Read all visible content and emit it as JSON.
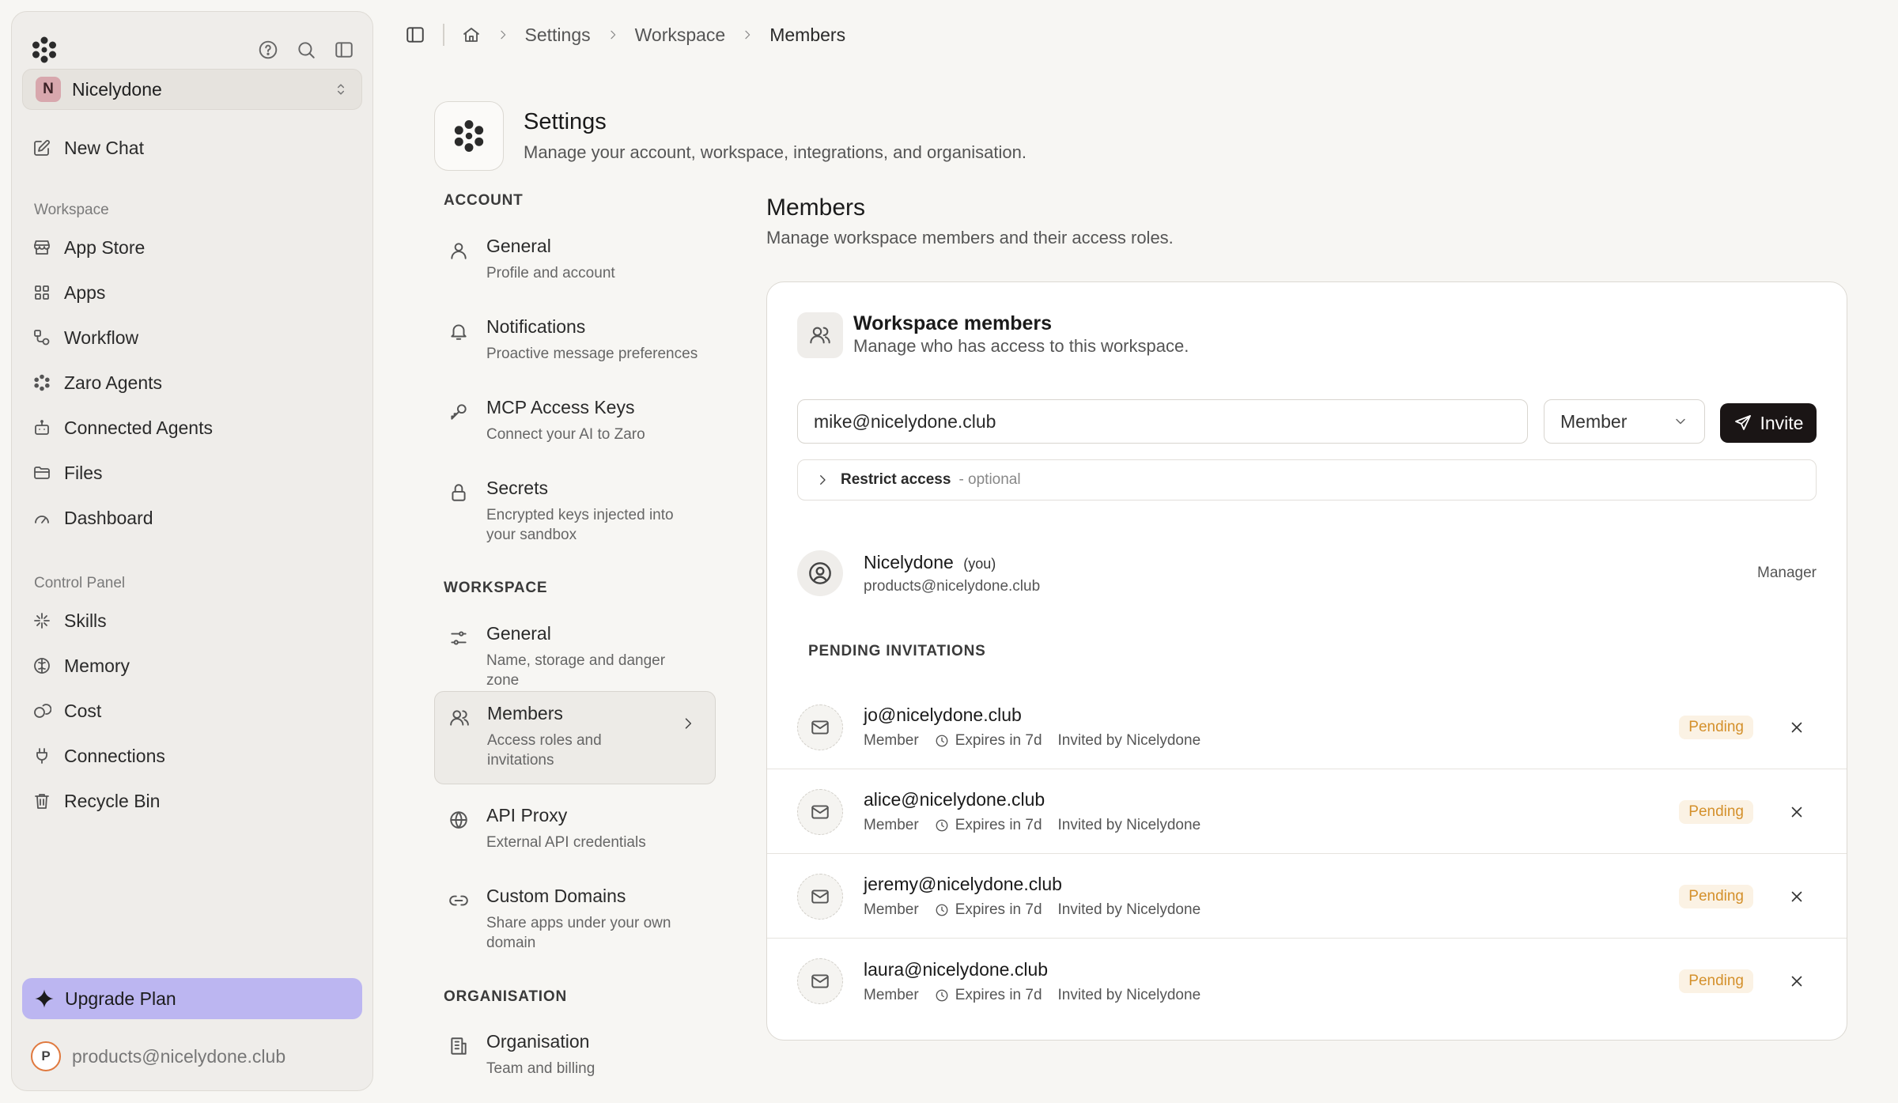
{
  "sidebar": {
    "workspace": {
      "initial": "N",
      "name": "Nicelydone"
    },
    "new_chat": "New Chat",
    "sections": {
      "workspace": "Workspace",
      "control_panel": "Control Panel"
    },
    "workspace_items": [
      {
        "label": "App Store",
        "icon": "store-icon"
      },
      {
        "label": "Apps",
        "icon": "apps-grid-icon"
      },
      {
        "label": "Workflow",
        "icon": "workflow-icon"
      },
      {
        "label": "Zaro Agents",
        "icon": "agents-icon"
      },
      {
        "label": "Connected Agents",
        "icon": "robot-icon"
      },
      {
        "label": "Files",
        "icon": "folder-icon"
      },
      {
        "label": "Dashboard",
        "icon": "gauge-icon"
      }
    ],
    "control_items": [
      {
        "label": "Skills",
        "icon": "sparkle-icon"
      },
      {
        "label": "Memory",
        "icon": "brain-icon"
      },
      {
        "label": "Cost",
        "icon": "coins-icon"
      },
      {
        "label": "Connections",
        "icon": "plug-icon"
      },
      {
        "label": "Recycle Bin",
        "icon": "trash-icon"
      }
    ],
    "upgrade": "Upgrade Plan",
    "user": {
      "initial": "P",
      "email": "products@nicelydone.club"
    }
  },
  "breadcrumb": [
    "Settings",
    "Workspace",
    "Members"
  ],
  "settings": {
    "title": "Settings",
    "subtitle": "Manage your account, workspace, integrations, and organisation.",
    "nav_sections": {
      "account": "ACCOUNT",
      "workspace": "WORKSPACE",
      "organisation": "ORGANISATION"
    },
    "account_items": [
      {
        "title": "General",
        "desc": "Profile and account",
        "icon": "user-icon"
      },
      {
        "title": "Notifications",
        "desc": "Proactive message preferences",
        "icon": "bell-icon"
      },
      {
        "title": "MCP Access Keys",
        "desc": "Connect your AI to Zaro",
        "icon": "key-icon"
      },
      {
        "title": "Secrets",
        "desc": "Encrypted keys injected into your sandbox",
        "icon": "lock-icon"
      }
    ],
    "workspace_items": [
      {
        "title": "General",
        "desc": "Name, storage and danger zone",
        "icon": "sliders-icon"
      },
      {
        "title": "Members",
        "desc": "Access roles and invitations",
        "icon": "users-icon"
      },
      {
        "title": "API Proxy",
        "desc": "External API credentials",
        "icon": "globe-icon"
      },
      {
        "title": "Custom Domains",
        "desc": "Share apps under your own domain",
        "icon": "link-icon"
      }
    ],
    "organisation_items": [
      {
        "title": "Organisation",
        "desc": "Team and billing",
        "icon": "building-icon"
      }
    ]
  },
  "members": {
    "title": "Members",
    "subtitle": "Manage workspace members and their access roles.",
    "card_title": "Workspace members",
    "card_subtitle": "Manage who has access to this workspace.",
    "invite_email": "mike@nicelydone.club",
    "role": "Member",
    "invite_label": "Invite",
    "restrict_label": "Restrict access",
    "restrict_optional": "- optional",
    "current": {
      "name": "Nicelydone",
      "you": "(you)",
      "email": "products@nicelydone.club",
      "role": "Manager"
    },
    "pending_heading": "PENDING INVITATIONS",
    "invitations": [
      {
        "email": "jo@nicelydone.club",
        "role": "Member",
        "expires": "Expires in 7d",
        "invited_by": "Invited by Nicelydone",
        "status": "Pending"
      },
      {
        "email": "alice@nicelydone.club",
        "role": "Member",
        "expires": "Expires in 7d",
        "invited_by": "Invited by Nicelydone",
        "status": "Pending"
      },
      {
        "email": "jeremy@nicelydone.club",
        "role": "Member",
        "expires": "Expires in 7d",
        "invited_by": "Invited by Nicelydone",
        "status": "Pending"
      },
      {
        "email": "laura@nicelydone.club",
        "role": "Member",
        "expires": "Expires in 7d",
        "invited_by": "Invited by Nicelydone",
        "status": "Pending"
      }
    ]
  },
  "colors": {
    "background": "#f7f6f3",
    "sidebar": "#efedea",
    "upgrade": "#bcb6f1",
    "invite_button": "#1a1515",
    "pending_badge_text": "#d4902b",
    "pending_badge_bg": "#fbf2e4",
    "workspace_avatar": "#d8a7ad",
    "user_avatar_ring": "#e0793e"
  }
}
